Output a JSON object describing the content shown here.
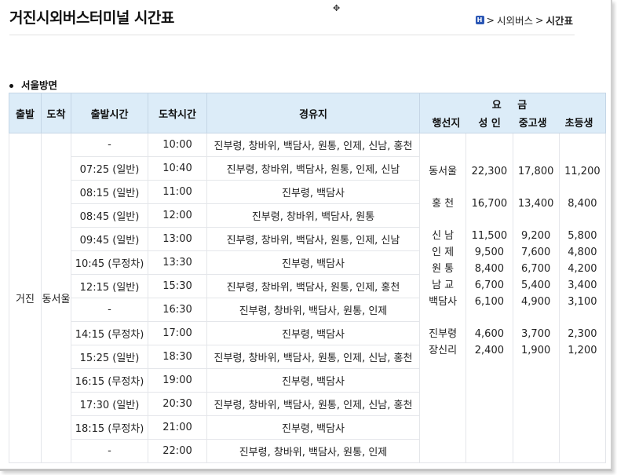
{
  "page": {
    "title": "거진시외버스터미널 시간표",
    "breadcrumb_icon": "home-icon",
    "breadcrumb_mid": "시외버스",
    "breadcrumb_current": "시간표",
    "section_label": "서울방면"
  },
  "table": {
    "headers": {
      "depart": "출발",
      "arrive": "도착",
      "depart_time": "출발시간",
      "arrive_time": "도착시간",
      "via": "경유지",
      "fare": "요 금",
      "dest": "행선지",
      "adult": "성 인",
      "teen": "중고생",
      "child": "초등생"
    },
    "origin": "거진",
    "destination": "동서울",
    "rows": [
      {
        "dep": "-",
        "arr": "10:00",
        "via": "진부령, 창바위, 백담사, 원통, 인제, 신남, 홍천"
      },
      {
        "dep": "07:25 (일반)",
        "arr": "10:40",
        "via": "진부령, 창바위, 백담사, 원통, 인제, 신남"
      },
      {
        "dep": "08:15 (일반)",
        "arr": "11:00",
        "via": "진부령, 백담사"
      },
      {
        "dep": "08:45 (일반)",
        "arr": "12:00",
        "via": "진부령, 창바위, 백담사, 원통"
      },
      {
        "dep": "09:45 (일반)",
        "arr": "13:00",
        "via": "진부령, 창바위, 백담사, 원통, 인제, 신남"
      },
      {
        "dep": "10:45 (무정차)",
        "arr": "13:30",
        "via": "진부령, 백담사"
      },
      {
        "dep": "12:15 (일반)",
        "arr": "15:30",
        "via": "진부령, 창바위, 백담사, 원통, 인제, 홍천"
      },
      {
        "dep": "-",
        "arr": "16:30",
        "via": "진부령, 창바위, 백담사, 원통, 인제"
      },
      {
        "dep": "14:15 (무정차)",
        "arr": "17:00",
        "via": "진부령, 백담사"
      },
      {
        "dep": "15:25 (일반)",
        "arr": "18:30",
        "via": "진부령, 창바위, 백담사, 원통, 인제, 신남, 홍천"
      },
      {
        "dep": "16:15 (무정차)",
        "arr": "19:00",
        "via": "진부령, 백담사"
      },
      {
        "dep": "17:30 (일반)",
        "arr": "20:30",
        "via": "진부령, 창바위, 백담사, 원통, 인제, 신남, 홍천"
      },
      {
        "dep": "18:15 (무정차)",
        "arr": "21:00",
        "via": "진부령, 백담사"
      },
      {
        "dep": "-",
        "arr": "22:00",
        "via": "진부령, 창바위, 백담사, 원통, 인제"
      }
    ],
    "fares": {
      "dests": [
        "동서울",
        "홍 천",
        "신 남",
        "인 제",
        "원 통",
        "남 교",
        "백담사",
        "진부령",
        "장신리"
      ],
      "adult": [
        "22,300",
        "16,700",
        "11,500",
        "9,500",
        "8,400",
        "6,700",
        "6,100",
        "4,600",
        "2,400"
      ],
      "teen": [
        "17,800",
        "13,400",
        "9,200",
        "7,600",
        "6,700",
        "5,400",
        "4,900",
        "3,700",
        "1,900"
      ],
      "child": [
        "11,200",
        "8,400",
        "5,800",
        "4,800",
        "4,200",
        "3,400",
        "3,100",
        "2,300",
        "1,200"
      ]
    }
  }
}
